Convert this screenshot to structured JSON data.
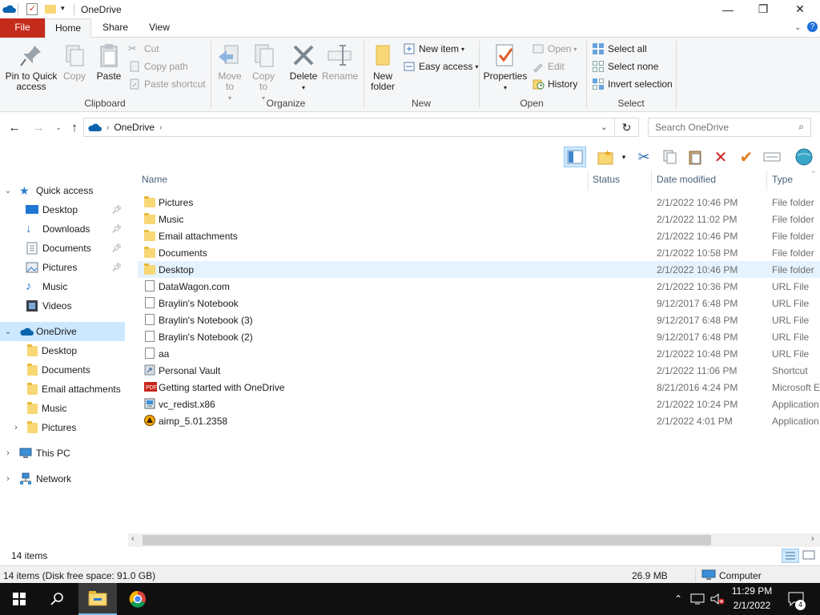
{
  "window": {
    "title": "OneDrive",
    "minimize_glyph": "—",
    "maximize_glyph": "❐",
    "close_glyph": "✕"
  },
  "ribbon_tabs": [
    "File",
    "Home",
    "Share",
    "View"
  ],
  "ribbon": {
    "clipboard": {
      "label": "Clipboard",
      "pin": "Pin to Quick access",
      "copy": "Copy",
      "paste": "Paste",
      "cut": "Cut",
      "copy_path": "Copy path",
      "paste_shortcut": "Paste shortcut"
    },
    "organize": {
      "label": "Organize",
      "move_to": "Move to",
      "copy_to": "Copy to",
      "delete": "Delete",
      "rename": "Rename"
    },
    "new": {
      "label": "New",
      "new_folder": "New folder",
      "new_item": "New item",
      "easy_access": "Easy access"
    },
    "open": {
      "label": "Open",
      "properties": "Properties",
      "open": "Open",
      "edit": "Edit",
      "history": "History"
    },
    "select": {
      "label": "Select",
      "select_all": "Select all",
      "select_none": "Select none",
      "invert": "Invert selection"
    }
  },
  "address": {
    "path": [
      "OneDrive"
    ],
    "search_placeholder": "Search OneDrive"
  },
  "columns": [
    "Name",
    "Status",
    "Date modified",
    "Type"
  ],
  "files": [
    {
      "name": "Pictures",
      "date": "2/1/2022 10:46 PM",
      "type": "File folder",
      "icon": "folder-icon"
    },
    {
      "name": "Music",
      "date": "2/1/2022 11:02 PM",
      "type": "File folder",
      "icon": "folder-icon"
    },
    {
      "name": "Email attachments",
      "date": "2/1/2022 10:46 PM",
      "type": "File folder",
      "icon": "folder-icon"
    },
    {
      "name": "Documents",
      "date": "2/1/2022 10:58 PM",
      "type": "File folder",
      "icon": "folder-icon"
    },
    {
      "name": "Desktop",
      "date": "2/1/2022 10:46 PM",
      "type": "File folder",
      "icon": "folder-icon"
    },
    {
      "name": "DataWagon.com",
      "date": "2/1/2022 10:36 PM",
      "type": "URL File",
      "icon": "file-icon"
    },
    {
      "name": "Braylin's Notebook",
      "date": "9/12/2017 6:48 PM",
      "type": "URL File",
      "icon": "file-icon"
    },
    {
      "name": "Braylin's Notebook (3)",
      "date": "9/12/2017 6:48 PM",
      "type": "URL File",
      "icon": "file-icon"
    },
    {
      "name": "Braylin's Notebook (2)",
      "date": "9/12/2017 6:48 PM",
      "type": "URL File",
      "icon": "file-icon"
    },
    {
      "name": "aa",
      "date": "2/1/2022 10:48 PM",
      "type": "URL File",
      "icon": "file-icon"
    },
    {
      "name": "Personal Vault",
      "date": "2/1/2022 11:06 PM",
      "type": "Shortcut",
      "icon": "shortcut-icon"
    },
    {
      "name": "Getting started with OneDrive",
      "date": "8/21/2016 4:24 PM",
      "type": "Microsoft E",
      "icon": "pdf-icon"
    },
    {
      "name": "vc_redist.x86",
      "date": "2/1/2022 10:24 PM",
      "type": "Application",
      "icon": "installer-icon"
    },
    {
      "name": "aimp_5.01.2358",
      "date": "2/1/2022 4:01 PM",
      "type": "Application",
      "icon": "aimp-icon"
    }
  ],
  "nav": {
    "quick_access": "Quick access",
    "qa_items": [
      "Desktop",
      "Downloads",
      "Documents",
      "Pictures",
      "Music",
      "Videos"
    ],
    "onedrive": "OneDrive",
    "od_items": [
      "Desktop",
      "Documents",
      "Email attachments",
      "Music",
      "Pictures"
    ],
    "this_pc": "This PC",
    "network": "Network"
  },
  "status": {
    "items": "14 items",
    "detail": "14 items (Disk free space: 91.0 GB)",
    "size": "26.9 MB",
    "location": "Computer"
  },
  "taskbar": {
    "time": "11:29 PM",
    "date": "2/1/2022",
    "notifications": "4"
  },
  "colors": {
    "accent_file_tab": "#c42b1c",
    "selection": "#cce8ff",
    "taskbar": "#101010"
  }
}
